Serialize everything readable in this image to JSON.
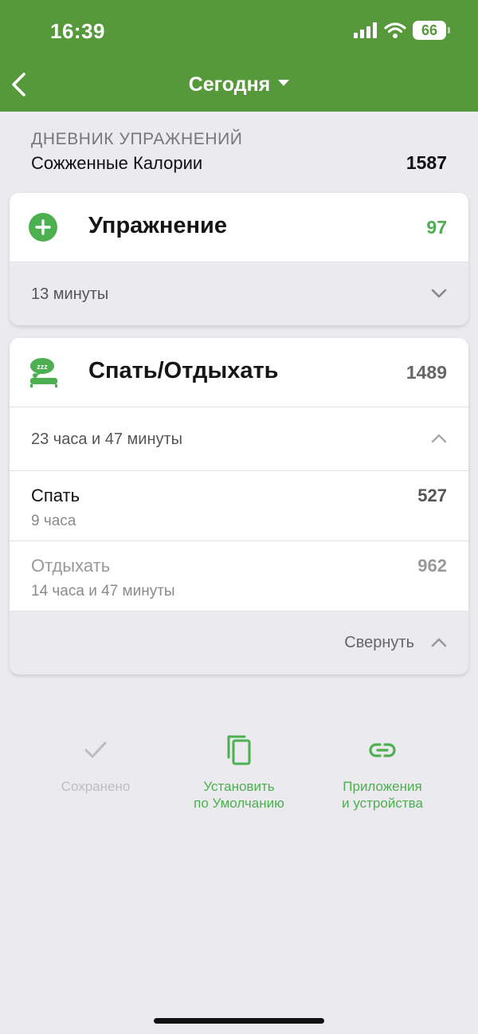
{
  "status_bar": {
    "time": "16:39",
    "battery": "66"
  },
  "nav": {
    "title": "Сегодня"
  },
  "diary": {
    "section_label": "ДНЕВНИК УПРАЖНЕНИЙ",
    "summary_label": "Сожженные Калории",
    "summary_value": "1587"
  },
  "exercise_card": {
    "title": "Упражнение",
    "value": "97",
    "duration": "13 минуты"
  },
  "sleep_card": {
    "title": "Спать/Отдыхать",
    "value": "1489",
    "duration": "23 часа и 47 минуты",
    "entries": [
      {
        "name": "Спать",
        "duration": "9 часа",
        "value": "527"
      },
      {
        "name": "Отдыхать",
        "duration": "14 часа и 47 минуты",
        "value": "962"
      }
    ],
    "collapse_label": "Свернуть"
  },
  "actions": {
    "saved": {
      "line1": "Сохранено"
    },
    "set_default": {
      "line1": "Установить",
      "line2": "по Умолчанию"
    },
    "apps": {
      "line1": "Приложения",
      "line2": "и устройства"
    }
  },
  "colors": {
    "brand_green": "#55993a",
    "accent_green": "#4caf50",
    "muted": "#bdbdbd"
  }
}
